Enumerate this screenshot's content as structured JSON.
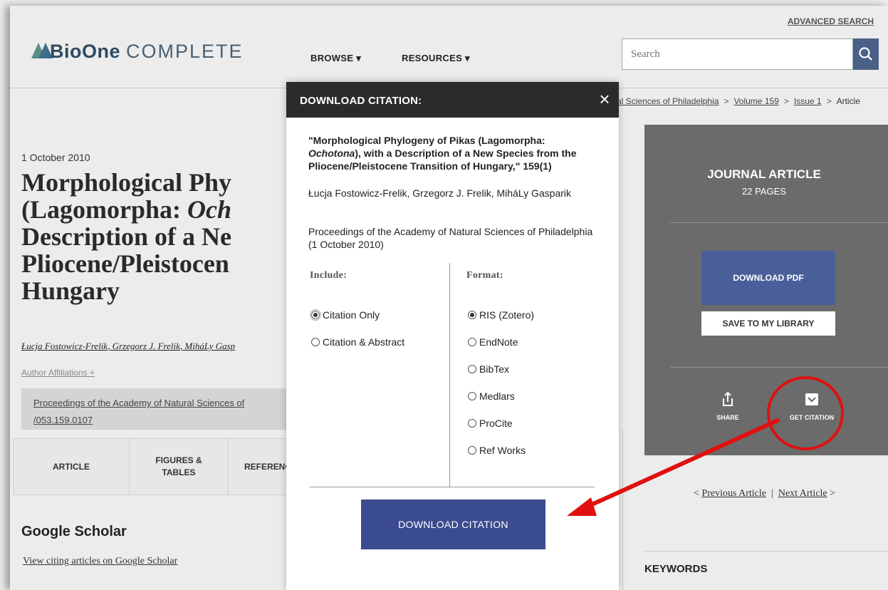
{
  "header": {
    "logo_brand": "BioOne",
    "logo_suffix": "COMPLETE",
    "nav": [
      "BROWSE",
      "RESOURCES"
    ],
    "advanced_search": "ADVANCED SEARCH",
    "search_placeholder": "Search",
    "icons": {
      "search": "search-icon",
      "dropdown": "caret-down-icon"
    }
  },
  "breadcrumb": [
    "al Sciences of Philadelphia",
    "Volume 159",
    "Issue 1",
    "Article"
  ],
  "article": {
    "date": "1 October 2010",
    "title_lines": [
      "Morphological Phy",
      "(Lagomorpha: ",
      "Description of a Ne",
      "Pliocene/Pleistocen",
      "Hungary"
    ],
    "title_italic": "Och",
    "authors": [
      "Łucja Fostowicz-Frelik",
      "Grzegorz J. Frelik",
      "MiháLy Gasp"
    ],
    "affiliations": "Author Affiliations +",
    "journal_line1": "Proceedings of the Academy of Natural Sciences of",
    "journal_line2": "/053.159.0107",
    "tabs": [
      "ARTICLE",
      "FIGURES & TABLES",
      "REFERENC"
    ],
    "google_scholar_title": "Google Scholar",
    "google_scholar_link": "View citing articles on Google Scholar"
  },
  "sidebar": {
    "type": "JOURNAL ARTICLE",
    "pages": "22 PAGES",
    "download_pdf": "DOWNLOAD PDF",
    "save_library": "SAVE TO MY LIBRARY",
    "share": "SHARE",
    "get_citation": "GET CITATION",
    "prev_article": "Previous Article",
    "next_article": "Next Article",
    "keywords": "KEYWORDS"
  },
  "modal": {
    "title": "DOWNLOAD CITATION:",
    "close": "×",
    "citation_title_1": "\"Morphological Phylogeny of Pikas (Lagomorpha:",
    "citation_title_italic": "Ochotona",
    "citation_title_2": "), with a Description of a New Species from the Pliocene/Pleistocene Transition of Hungary,\" 159(1)",
    "authors": "Łucja Fostowicz-Frelik, Grzegorz J. Frelik, MiháLy Gasparik",
    "source": "Proceedings of the Academy of Natural Sciences of Philadelphia (1 October 2010)",
    "include_label": "Include:",
    "format_label": "Format:",
    "include_options": [
      {
        "label": "Citation Only",
        "selected": true
      },
      {
        "label": "Citation & Abstract",
        "selected": false
      }
    ],
    "format_options": [
      {
        "label": "RIS (Zotero)",
        "selected": true
      },
      {
        "label": "EndNote",
        "selected": false
      },
      {
        "label": "BibTex",
        "selected": false
      },
      {
        "label": "Medlars",
        "selected": false
      },
      {
        "label": "ProCite",
        "selected": false
      },
      {
        "label": "Ref Works",
        "selected": false
      }
    ],
    "download_button": "DOWNLOAD CITATION"
  },
  "annotation": {
    "highlight_color": "#e01010"
  }
}
